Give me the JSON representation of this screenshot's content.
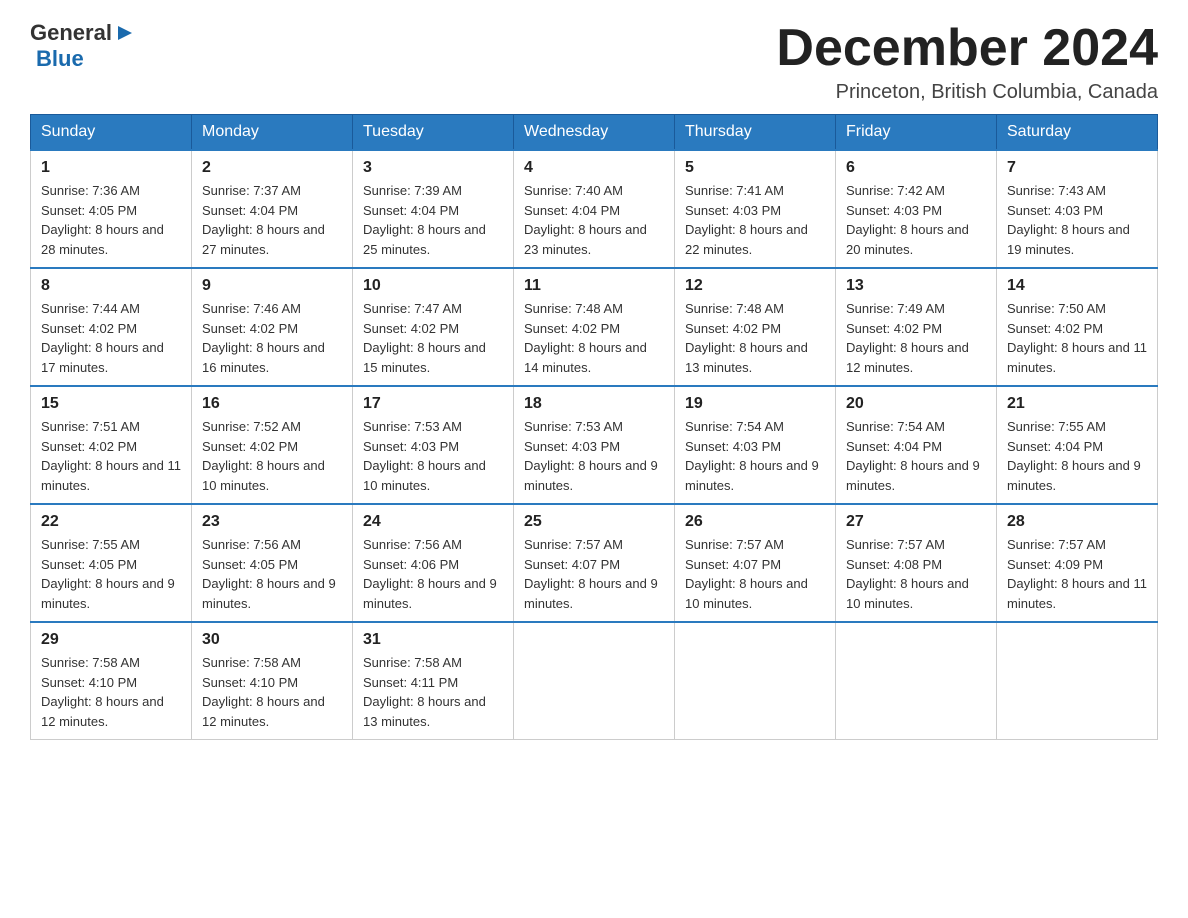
{
  "header": {
    "title": "December 2024",
    "location": "Princeton, British Columbia, Canada",
    "logo_general": "General",
    "logo_blue": "Blue"
  },
  "weekdays": [
    "Sunday",
    "Monday",
    "Tuesday",
    "Wednesday",
    "Thursday",
    "Friday",
    "Saturday"
  ],
  "weeks": [
    [
      {
        "day": "1",
        "sunrise": "7:36 AM",
        "sunset": "4:05 PM",
        "daylight": "8 hours and 28 minutes."
      },
      {
        "day": "2",
        "sunrise": "7:37 AM",
        "sunset": "4:04 PM",
        "daylight": "8 hours and 27 minutes."
      },
      {
        "day": "3",
        "sunrise": "7:39 AM",
        "sunset": "4:04 PM",
        "daylight": "8 hours and 25 minutes."
      },
      {
        "day": "4",
        "sunrise": "7:40 AM",
        "sunset": "4:04 PM",
        "daylight": "8 hours and 23 minutes."
      },
      {
        "day": "5",
        "sunrise": "7:41 AM",
        "sunset": "4:03 PM",
        "daylight": "8 hours and 22 minutes."
      },
      {
        "day": "6",
        "sunrise": "7:42 AM",
        "sunset": "4:03 PM",
        "daylight": "8 hours and 20 minutes."
      },
      {
        "day": "7",
        "sunrise": "7:43 AM",
        "sunset": "4:03 PM",
        "daylight": "8 hours and 19 minutes."
      }
    ],
    [
      {
        "day": "8",
        "sunrise": "7:44 AM",
        "sunset": "4:02 PM",
        "daylight": "8 hours and 17 minutes."
      },
      {
        "day": "9",
        "sunrise": "7:46 AM",
        "sunset": "4:02 PM",
        "daylight": "8 hours and 16 minutes."
      },
      {
        "day": "10",
        "sunrise": "7:47 AM",
        "sunset": "4:02 PM",
        "daylight": "8 hours and 15 minutes."
      },
      {
        "day": "11",
        "sunrise": "7:48 AM",
        "sunset": "4:02 PM",
        "daylight": "8 hours and 14 minutes."
      },
      {
        "day": "12",
        "sunrise": "7:48 AM",
        "sunset": "4:02 PM",
        "daylight": "8 hours and 13 minutes."
      },
      {
        "day": "13",
        "sunrise": "7:49 AM",
        "sunset": "4:02 PM",
        "daylight": "8 hours and 12 minutes."
      },
      {
        "day": "14",
        "sunrise": "7:50 AM",
        "sunset": "4:02 PM",
        "daylight": "8 hours and 11 minutes."
      }
    ],
    [
      {
        "day": "15",
        "sunrise": "7:51 AM",
        "sunset": "4:02 PM",
        "daylight": "8 hours and 11 minutes."
      },
      {
        "day": "16",
        "sunrise": "7:52 AM",
        "sunset": "4:02 PM",
        "daylight": "8 hours and 10 minutes."
      },
      {
        "day": "17",
        "sunrise": "7:53 AM",
        "sunset": "4:03 PM",
        "daylight": "8 hours and 10 minutes."
      },
      {
        "day": "18",
        "sunrise": "7:53 AM",
        "sunset": "4:03 PM",
        "daylight": "8 hours and 9 minutes."
      },
      {
        "day": "19",
        "sunrise": "7:54 AM",
        "sunset": "4:03 PM",
        "daylight": "8 hours and 9 minutes."
      },
      {
        "day": "20",
        "sunrise": "7:54 AM",
        "sunset": "4:04 PM",
        "daylight": "8 hours and 9 minutes."
      },
      {
        "day": "21",
        "sunrise": "7:55 AM",
        "sunset": "4:04 PM",
        "daylight": "8 hours and 9 minutes."
      }
    ],
    [
      {
        "day": "22",
        "sunrise": "7:55 AM",
        "sunset": "4:05 PM",
        "daylight": "8 hours and 9 minutes."
      },
      {
        "day": "23",
        "sunrise": "7:56 AM",
        "sunset": "4:05 PM",
        "daylight": "8 hours and 9 minutes."
      },
      {
        "day": "24",
        "sunrise": "7:56 AM",
        "sunset": "4:06 PM",
        "daylight": "8 hours and 9 minutes."
      },
      {
        "day": "25",
        "sunrise": "7:57 AM",
        "sunset": "4:07 PM",
        "daylight": "8 hours and 9 minutes."
      },
      {
        "day": "26",
        "sunrise": "7:57 AM",
        "sunset": "4:07 PM",
        "daylight": "8 hours and 10 minutes."
      },
      {
        "day": "27",
        "sunrise": "7:57 AM",
        "sunset": "4:08 PM",
        "daylight": "8 hours and 10 minutes."
      },
      {
        "day": "28",
        "sunrise": "7:57 AM",
        "sunset": "4:09 PM",
        "daylight": "8 hours and 11 minutes."
      }
    ],
    [
      {
        "day": "29",
        "sunrise": "7:58 AM",
        "sunset": "4:10 PM",
        "daylight": "8 hours and 12 minutes."
      },
      {
        "day": "30",
        "sunrise": "7:58 AM",
        "sunset": "4:10 PM",
        "daylight": "8 hours and 12 minutes."
      },
      {
        "day": "31",
        "sunrise": "7:58 AM",
        "sunset": "4:11 PM",
        "daylight": "8 hours and 13 minutes."
      },
      null,
      null,
      null,
      null
    ]
  ]
}
